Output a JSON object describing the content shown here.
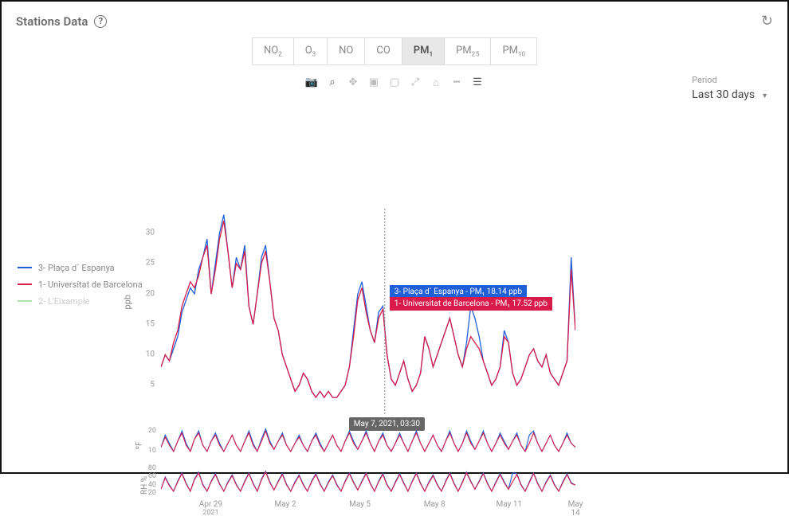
{
  "header": {
    "title": "Stations Data",
    "help_tooltip": "?"
  },
  "tabs": [
    {
      "label": "NO",
      "sub": "2"
    },
    {
      "label": "O",
      "sub": "3"
    },
    {
      "label": "NO",
      "sub": ""
    },
    {
      "label": "CO",
      "sub": ""
    },
    {
      "label": "PM",
      "sub": "1",
      "selected": true
    },
    {
      "label": "PM",
      "sub": "2 5"
    },
    {
      "label": "PM",
      "sub": "10"
    }
  ],
  "toolbar": [
    {
      "name": "camera-icon",
      "glyph": "📷",
      "active": false
    },
    {
      "name": "zoom-icon",
      "glyph": "⌕",
      "active": true
    },
    {
      "name": "pan-icon",
      "glyph": "✥",
      "active": false
    },
    {
      "name": "zoom-in-icon",
      "glyph": "▣",
      "active": false
    },
    {
      "name": "zoom-out-icon",
      "glyph": "▢",
      "active": false
    },
    {
      "name": "autoscale-icon",
      "glyph": "⤢",
      "active": false
    },
    {
      "name": "home-icon",
      "glyph": "⌂",
      "active": false
    },
    {
      "name": "spike-icon",
      "glyph": "━",
      "active": false
    },
    {
      "name": "compare-icon",
      "glyph": "☰",
      "active": true
    }
  ],
  "period": {
    "label": "Period",
    "value": "Last 30 days"
  },
  "legend": [
    {
      "color": "#1f5fd8",
      "label": "3- Plaça d´ Espanya",
      "active": true
    },
    {
      "color": "#d81b4a",
      "label": "1- Universitat de Barcelona",
      "active": true
    },
    {
      "color": "#b5e0b5",
      "label": "2- L'Eixample",
      "active": false
    }
  ],
  "hover": {
    "time_label": "May 7, 2021, 03:30",
    "x_frac": 0.54,
    "tips": [
      {
        "color_class": "blue",
        "text": "3- Plaça d´ Espanya - PM₁ 18.14 ppb",
        "y": 0.4
      },
      {
        "color_class": "red",
        "text": "1- Universitat de Barcelona - PM₁ 17.52 ppb",
        "y": 0.46
      }
    ]
  },
  "chart_data": {
    "type": "line",
    "title": "",
    "ylabel": "ppb",
    "ylim": [
      0,
      34
    ],
    "yticks": [
      5,
      10,
      15,
      20,
      25,
      30
    ],
    "x_labels": [
      "Apr 29",
      "May 2",
      "May 5",
      "May 8",
      "May 11",
      "May 14"
    ],
    "x_year": "2021",
    "x_tick_frac": [
      0.12,
      0.3,
      0.48,
      0.66,
      0.84,
      1.0
    ],
    "series": [
      {
        "name": "3- Plaça d´ Espanya",
        "color": "#1f5fd8",
        "values": [
          8,
          10,
          9,
          11,
          13,
          17,
          19,
          21,
          20,
          24,
          26,
          29,
          20,
          25,
          30,
          33,
          27,
          21,
          26,
          24,
          28,
          18,
          15,
          20,
          26,
          28,
          22,
          16,
          14,
          10,
          8,
          6,
          4,
          5,
          7,
          6,
          4,
          3,
          4,
          3,
          4,
          3,
          3,
          4,
          5,
          8,
          14,
          20,
          22,
          18,
          14,
          12,
          17,
          18,
          10,
          6,
          5,
          7,
          9,
          6,
          4,
          5,
          7,
          13,
          11,
          8,
          10,
          12,
          14,
          16,
          13,
          10,
          8,
          12,
          18,
          16,
          13,
          9,
          7,
          5,
          6,
          8,
          14,
          12,
          7,
          5,
          6,
          8,
          10,
          11,
          9,
          8,
          10,
          7,
          6,
          5,
          7,
          9,
          26,
          14
        ]
      },
      {
        "name": "1- Universitat de Barcelona",
        "color": "#d81b4a",
        "values": [
          8,
          10,
          9,
          12,
          14,
          18,
          20,
          22,
          21,
          23,
          26,
          28,
          20,
          24,
          29,
          32,
          27,
          21,
          25,
          24,
          27,
          18,
          15,
          20,
          25,
          27,
          22,
          16,
          14,
          10,
          8,
          6,
          4,
          5,
          7,
          6,
          4,
          3,
          4,
          3,
          4,
          3,
          3,
          4,
          5,
          8,
          13,
          19,
          21,
          17,
          14,
          12,
          16,
          17.5,
          10,
          6,
          5,
          7,
          9,
          6,
          4,
          5,
          7,
          13,
          11,
          8,
          10,
          12,
          14,
          16,
          13,
          10,
          8,
          11,
          13,
          12,
          11,
          9,
          7,
          5,
          6,
          8,
          13,
          12,
          7,
          5,
          6,
          8,
          10,
          11,
          9,
          8,
          10,
          7,
          6,
          5,
          7,
          9,
          24,
          14
        ]
      }
    ],
    "sub_panels": [
      {
        "ylabel": "ºF",
        "ylim": [
          8,
          22
        ],
        "yticks": [
          10,
          20
        ],
        "series": [
          {
            "name": "3- Plaça d´ Espanya",
            "color": "#1f5fd8",
            "values": [
              12,
              18,
              14,
              10,
              15,
              20,
              14,
              10,
              16,
              20,
              13,
              10,
              15,
              19,
              14,
              10,
              14,
              18,
              13,
              10,
              15,
              20,
              14,
              10,
              16,
              21,
              15,
              11,
              15,
              19,
              13,
              10,
              14,
              18,
              13,
              10,
              15,
              19,
              14,
              10,
              14,
              18,
              13,
              10,
              15,
              20,
              15,
              11,
              15,
              20,
              14,
              10,
              15,
              19,
              13,
              10,
              14,
              19,
              14,
              10,
              15,
              20,
              14,
              10,
              14,
              18,
              13,
              10,
              15,
              20,
              14,
              10,
              14,
              20,
              15,
              11,
              15,
              20,
              14,
              10,
              14,
              19,
              15,
              11,
              15,
              19,
              13,
              10,
              18,
              20,
              14,
              10,
              14,
              18,
              13,
              10,
              14,
              19,
              14,
              12
            ]
          },
          {
            "name": "1- Universitat de Barcelona",
            "color": "#d81b4a",
            "values": [
              12,
              17,
              13,
              10,
              15,
              19,
              13,
              10,
              16,
              19,
              13,
              10,
              15,
              18,
              13,
              10,
              14,
              18,
              13,
              10,
              15,
              19,
              13,
              10,
              15,
              20,
              14,
              11,
              15,
              18,
              13,
              10,
              14,
              17,
              13,
              10,
              15,
              18,
              13,
              10,
              14,
              18,
              13,
              10,
              15,
              19,
              14,
              11,
              15,
              19,
              14,
              10,
              15,
              18,
              13,
              10,
              14,
              18,
              14,
              10,
              15,
              19,
              14,
              10,
              14,
              18,
              13,
              10,
              15,
              19,
              14,
              10,
              14,
              19,
              14,
              11,
              15,
              19,
              14,
              10,
              14,
              18,
              14,
              11,
              15,
              18,
              13,
              10,
              14,
              19,
              14,
              10,
              14,
              18,
              13,
              10,
              14,
              18,
              14,
              12
            ]
          }
        ]
      },
      {
        "ylabel": "RH %",
        "ylim": [
          15,
          85
        ],
        "yticks": [
          20,
          40,
          60,
          80
        ],
        "series": [
          {
            "name": "3- Plaça d´ Espanya",
            "color": "#1f5fd8",
            "values": [
              30,
              60,
              40,
              25,
              50,
              70,
              45,
              25,
              55,
              72,
              42,
              25,
              50,
              68,
              44,
              25,
              48,
              65,
              42,
              25,
              50,
              70,
              45,
              25,
              55,
              74,
              48,
              28,
              50,
              68,
              42,
              25,
              48,
              65,
              42,
              25,
              50,
              68,
              44,
              25,
              48,
              65,
              42,
              25,
              50,
              70,
              48,
              28,
              50,
              70,
              45,
              25,
              50,
              68,
              42,
              25,
              48,
              68,
              46,
              25,
              50,
              70,
              45,
              25,
              48,
              65,
              42,
              25,
              50,
              70,
              45,
              25,
              48,
              72,
              50,
              30,
              50,
              70,
              45,
              25,
              48,
              68,
              48,
              30,
              70,
              68,
              42,
              25,
              48,
              70,
              45,
              25,
              48,
              65,
              42,
              25,
              48,
              68,
              46,
              40
            ]
          },
          {
            "name": "1- Universitat de Barcelona",
            "color": "#d81b4a",
            "values": [
              30,
              58,
              38,
              25,
              48,
              68,
              43,
              25,
              53,
              70,
              40,
              25,
              48,
              66,
              42,
              25,
              46,
              63,
              40,
              25,
              48,
              68,
              43,
              25,
              53,
              72,
              46,
              28,
              48,
              66,
              40,
              25,
              46,
              63,
              40,
              25,
              48,
              66,
              42,
              25,
              46,
              63,
              40,
              25,
              48,
              68,
              46,
              28,
              48,
              68,
              43,
              25,
              48,
              66,
              40,
              25,
              46,
              66,
              44,
              25,
              48,
              68,
              43,
              25,
              46,
              63,
              40,
              25,
              48,
              68,
              43,
              25,
              46,
              70,
              48,
              30,
              48,
              68,
              43,
              25,
              46,
              66,
              46,
              30,
              48,
              66,
              40,
              25,
              46,
              68,
              43,
              25,
              46,
              63,
              40,
              25,
              46,
              66,
              44,
              40
            ]
          }
        ]
      }
    ]
  }
}
